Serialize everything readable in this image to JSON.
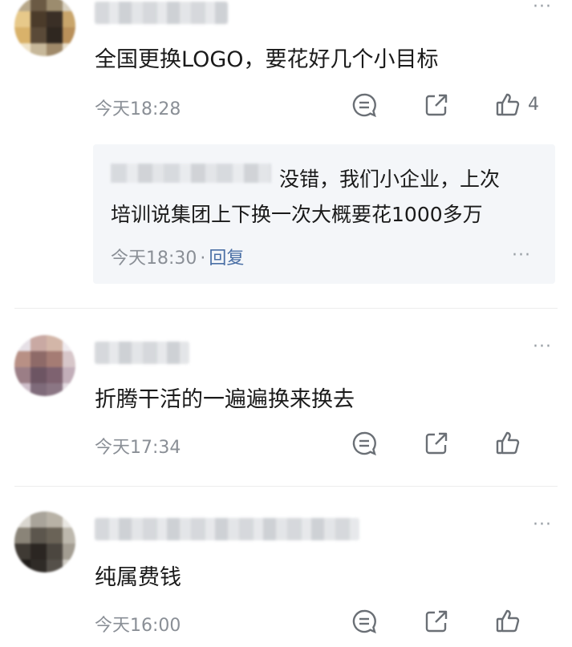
{
  "comments": [
    {
      "text": "全国更换LOGO，要花好几个小目标",
      "time": "今天18:28",
      "likes": "4",
      "reply": {
        "text_line1": "没错，我们小企业，上次",
        "text_line2": "培训说集团上下换一次大概要花1000多万",
        "time": "今天18:30",
        "dot": "·",
        "reply_label": "回复"
      }
    },
    {
      "text": "折腾干活的一遍遍换来换去",
      "time": "今天17:34"
    },
    {
      "text": "纯属费钱",
      "time": "今天16:00"
    }
  ],
  "more_glyph": "···",
  "icons": [
    "comment-icon",
    "share-icon",
    "thumbs-up-icon",
    "more-icon"
  ],
  "colors": {
    "secondary_text": "#8a8f96",
    "link": "#4a6fa5",
    "reply_bg": "#f4f6f9"
  }
}
